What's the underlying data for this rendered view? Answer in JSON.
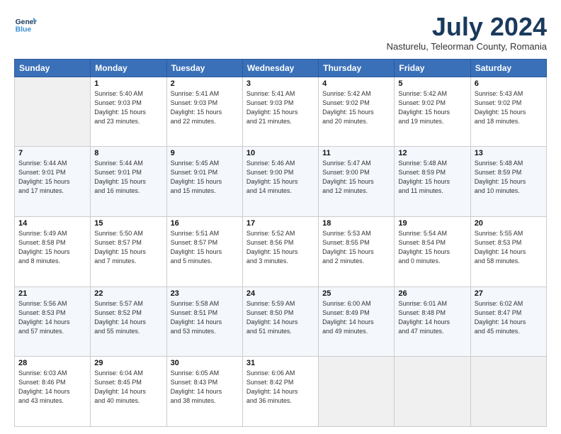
{
  "header": {
    "logo_line1": "General",
    "logo_line2": "Blue",
    "month_title": "July 2024",
    "subtitle": "Nasturelu, Teleorman County, Romania"
  },
  "days_of_week": [
    "Sunday",
    "Monday",
    "Tuesday",
    "Wednesday",
    "Thursday",
    "Friday",
    "Saturday"
  ],
  "weeks": [
    [
      {
        "day": "",
        "info": ""
      },
      {
        "day": "1",
        "info": "Sunrise: 5:40 AM\nSunset: 9:03 PM\nDaylight: 15 hours\nand 23 minutes."
      },
      {
        "day": "2",
        "info": "Sunrise: 5:41 AM\nSunset: 9:03 PM\nDaylight: 15 hours\nand 22 minutes."
      },
      {
        "day": "3",
        "info": "Sunrise: 5:41 AM\nSunset: 9:03 PM\nDaylight: 15 hours\nand 21 minutes."
      },
      {
        "day": "4",
        "info": "Sunrise: 5:42 AM\nSunset: 9:02 PM\nDaylight: 15 hours\nand 20 minutes."
      },
      {
        "day": "5",
        "info": "Sunrise: 5:42 AM\nSunset: 9:02 PM\nDaylight: 15 hours\nand 19 minutes."
      },
      {
        "day": "6",
        "info": "Sunrise: 5:43 AM\nSunset: 9:02 PM\nDaylight: 15 hours\nand 18 minutes."
      }
    ],
    [
      {
        "day": "7",
        "info": "Sunrise: 5:44 AM\nSunset: 9:01 PM\nDaylight: 15 hours\nand 17 minutes."
      },
      {
        "day": "8",
        "info": "Sunrise: 5:44 AM\nSunset: 9:01 PM\nDaylight: 15 hours\nand 16 minutes."
      },
      {
        "day": "9",
        "info": "Sunrise: 5:45 AM\nSunset: 9:01 PM\nDaylight: 15 hours\nand 15 minutes."
      },
      {
        "day": "10",
        "info": "Sunrise: 5:46 AM\nSunset: 9:00 PM\nDaylight: 15 hours\nand 14 minutes."
      },
      {
        "day": "11",
        "info": "Sunrise: 5:47 AM\nSunset: 9:00 PM\nDaylight: 15 hours\nand 12 minutes."
      },
      {
        "day": "12",
        "info": "Sunrise: 5:48 AM\nSunset: 8:59 PM\nDaylight: 15 hours\nand 11 minutes."
      },
      {
        "day": "13",
        "info": "Sunrise: 5:48 AM\nSunset: 8:59 PM\nDaylight: 15 hours\nand 10 minutes."
      }
    ],
    [
      {
        "day": "14",
        "info": "Sunrise: 5:49 AM\nSunset: 8:58 PM\nDaylight: 15 hours\nand 8 minutes."
      },
      {
        "day": "15",
        "info": "Sunrise: 5:50 AM\nSunset: 8:57 PM\nDaylight: 15 hours\nand 7 minutes."
      },
      {
        "day": "16",
        "info": "Sunrise: 5:51 AM\nSunset: 8:57 PM\nDaylight: 15 hours\nand 5 minutes."
      },
      {
        "day": "17",
        "info": "Sunrise: 5:52 AM\nSunset: 8:56 PM\nDaylight: 15 hours\nand 3 minutes."
      },
      {
        "day": "18",
        "info": "Sunrise: 5:53 AM\nSunset: 8:55 PM\nDaylight: 15 hours\nand 2 minutes."
      },
      {
        "day": "19",
        "info": "Sunrise: 5:54 AM\nSunset: 8:54 PM\nDaylight: 15 hours\nand 0 minutes."
      },
      {
        "day": "20",
        "info": "Sunrise: 5:55 AM\nSunset: 8:53 PM\nDaylight: 14 hours\nand 58 minutes."
      }
    ],
    [
      {
        "day": "21",
        "info": "Sunrise: 5:56 AM\nSunset: 8:53 PM\nDaylight: 14 hours\nand 57 minutes."
      },
      {
        "day": "22",
        "info": "Sunrise: 5:57 AM\nSunset: 8:52 PM\nDaylight: 14 hours\nand 55 minutes."
      },
      {
        "day": "23",
        "info": "Sunrise: 5:58 AM\nSunset: 8:51 PM\nDaylight: 14 hours\nand 53 minutes."
      },
      {
        "day": "24",
        "info": "Sunrise: 5:59 AM\nSunset: 8:50 PM\nDaylight: 14 hours\nand 51 minutes."
      },
      {
        "day": "25",
        "info": "Sunrise: 6:00 AM\nSunset: 8:49 PM\nDaylight: 14 hours\nand 49 minutes."
      },
      {
        "day": "26",
        "info": "Sunrise: 6:01 AM\nSunset: 8:48 PM\nDaylight: 14 hours\nand 47 minutes."
      },
      {
        "day": "27",
        "info": "Sunrise: 6:02 AM\nSunset: 8:47 PM\nDaylight: 14 hours\nand 45 minutes."
      }
    ],
    [
      {
        "day": "28",
        "info": "Sunrise: 6:03 AM\nSunset: 8:46 PM\nDaylight: 14 hours\nand 43 minutes."
      },
      {
        "day": "29",
        "info": "Sunrise: 6:04 AM\nSunset: 8:45 PM\nDaylight: 14 hours\nand 40 minutes."
      },
      {
        "day": "30",
        "info": "Sunrise: 6:05 AM\nSunset: 8:43 PM\nDaylight: 14 hours\nand 38 minutes."
      },
      {
        "day": "31",
        "info": "Sunrise: 6:06 AM\nSunset: 8:42 PM\nDaylight: 14 hours\nand 36 minutes."
      },
      {
        "day": "",
        "info": ""
      },
      {
        "day": "",
        "info": ""
      },
      {
        "day": "",
        "info": ""
      }
    ]
  ]
}
